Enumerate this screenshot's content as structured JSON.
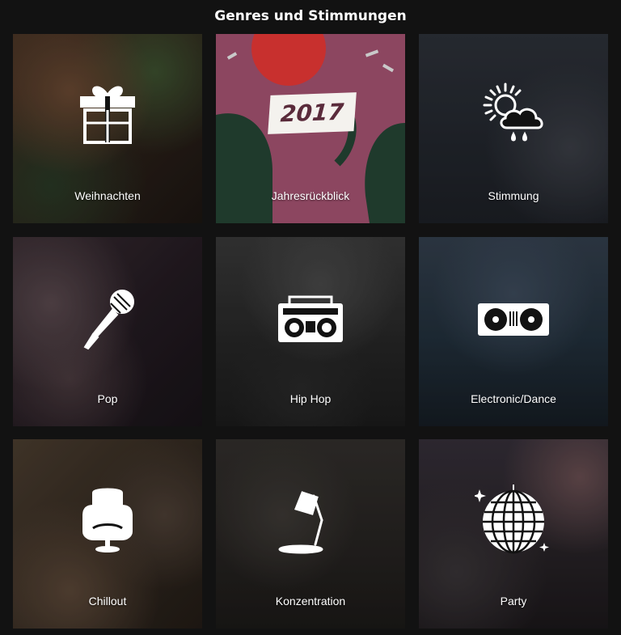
{
  "header": {
    "title": "Genres und Stimmungen"
  },
  "jahresrueckblick_badge": "2017",
  "tiles": [
    {
      "label": "Weihnachten",
      "icon": "gift-icon"
    },
    {
      "label": "Jahresrückblick",
      "icon": "year-2017-badge"
    },
    {
      "label": "Stimmung",
      "icon": "weather-sun-cloud-rain-icon"
    },
    {
      "label": "Pop",
      "icon": "microphone-icon"
    },
    {
      "label": "Hip Hop",
      "icon": "boombox-icon"
    },
    {
      "label": "Electronic/Dance",
      "icon": "turntables-icon"
    },
    {
      "label": "Chillout",
      "icon": "egg-chair-icon"
    },
    {
      "label": "Konzentration",
      "icon": "desk-lamp-icon"
    },
    {
      "label": "Party",
      "icon": "disco-ball-icon"
    }
  ],
  "colors": {
    "background": "#121212",
    "text": "#ffffff",
    "jahresrueckblick_pink": "#8c4660",
    "jahresrueckblick_green": "#1f3a2c",
    "jahresrueckblick_red": "#c8302e"
  }
}
